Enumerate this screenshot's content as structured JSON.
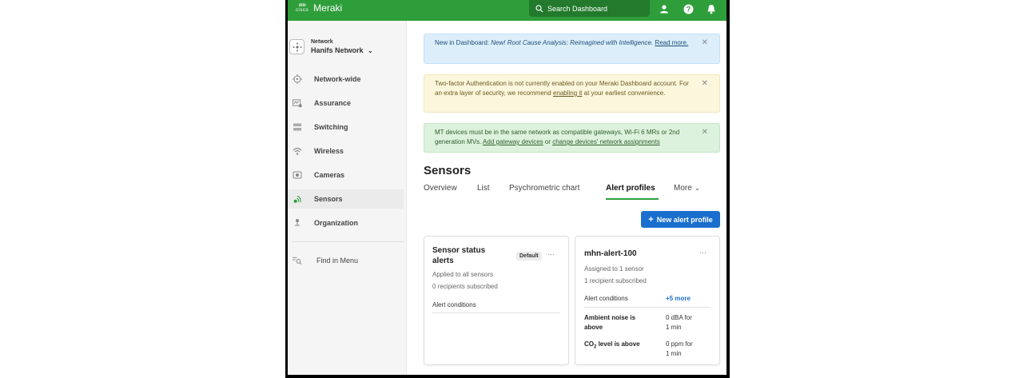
{
  "topbar": {
    "cisco_text": "cisco",
    "brand": "Meraki",
    "search_placeholder": "Search Dashboard"
  },
  "sidebar": {
    "network_label": "Network",
    "network_name": "Hanifs Network",
    "items": [
      {
        "label": "Network-wide",
        "icon": "network-icon"
      },
      {
        "label": "Assurance",
        "icon": "assurance-icon"
      },
      {
        "label": "Switching",
        "icon": "switch-icon"
      },
      {
        "label": "Wireless",
        "icon": "wifi-icon"
      },
      {
        "label": "Cameras",
        "icon": "camera-icon"
      },
      {
        "label": "Sensors",
        "icon": "sensor-icon"
      },
      {
        "label": "Organization",
        "icon": "organization-icon"
      }
    ],
    "find_label": "Find in Menu"
  },
  "banners": {
    "blue": {
      "prefix": "New in Dashboard: ",
      "italic": "New! Root Cause Analysis: Reimagined with Intelligence.",
      "link": "Read more."
    },
    "yellow": {
      "text1": "Two-factor Authentication is not currently enabled on your Meraki Dashboard account. For an extra layer of security, we recommend ",
      "link": "enabling it",
      "text2": " at your earliest convenience."
    },
    "green": {
      "text1": "MT devices must be in the same network as compatible gateways, Wi-Fi 6 MRs or 2nd generation MVs. ",
      "link1": "Add gateway devices",
      "text2": " or ",
      "link2": "change devices' network assignments"
    }
  },
  "page": {
    "title": "Sensors",
    "tabs": [
      "Overview",
      "List",
      "Psychrometric chart",
      "Alert profiles",
      "More"
    ],
    "active_tab": "Alert profiles",
    "new_button": "New alert profile"
  },
  "cards": [
    {
      "title_line1": "Sensor status",
      "title_line2": "alerts",
      "badge": "Default",
      "applied": "Applied to all sensors",
      "recipients": "0 recipients subscribed",
      "conditions_label": "Alert conditions"
    },
    {
      "title": "mhn-alert-100",
      "assigned": "Assigned to 1 sensor",
      "recipients": "1 recipient subscribed",
      "conditions_label": "Alert conditions",
      "more_link": "+5 more",
      "conditions": [
        {
          "name_line1": "Ambient noise is",
          "name_line2": "above",
          "value_line1": "0 dBA for",
          "value_line2": "1 min"
        },
        {
          "name_prefix": "CO",
          "name_sub": "2",
          "name_suffix": " level is above",
          "value_line1": "0 ppm for",
          "value_line2": "1 min"
        }
      ]
    }
  ],
  "colors": {
    "topbar": "#2e9e3a",
    "primary_button": "#1a6fce",
    "active_tab_underline": "#2e9e3a"
  }
}
